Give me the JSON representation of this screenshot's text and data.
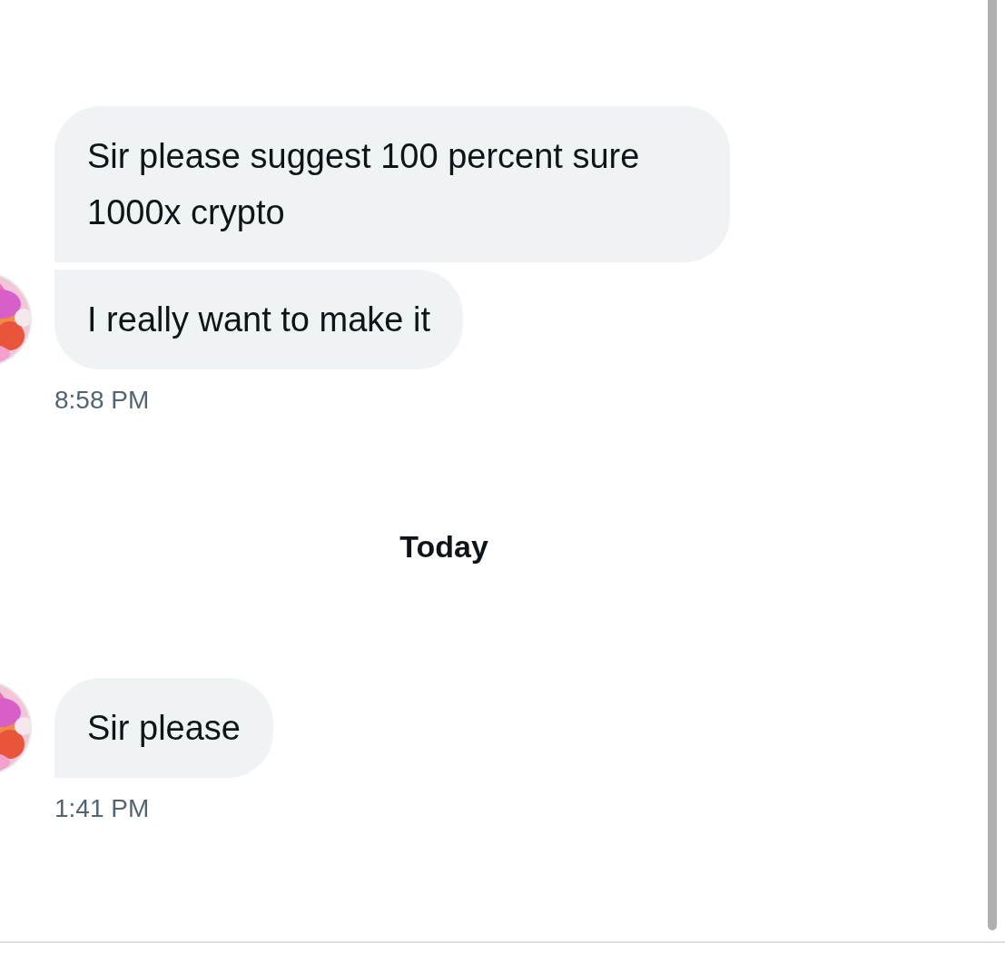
{
  "conversation": [
    {
      "kind": "group",
      "messages": [
        "Sir please suggest 100 percent sure 1000x crypto",
        "I really want to make it"
      ],
      "time": "8:58 PM"
    },
    {
      "kind": "date",
      "label": "Today"
    },
    {
      "kind": "group",
      "messages": [
        "Sir please"
      ],
      "time": "1:41 PM"
    }
  ]
}
